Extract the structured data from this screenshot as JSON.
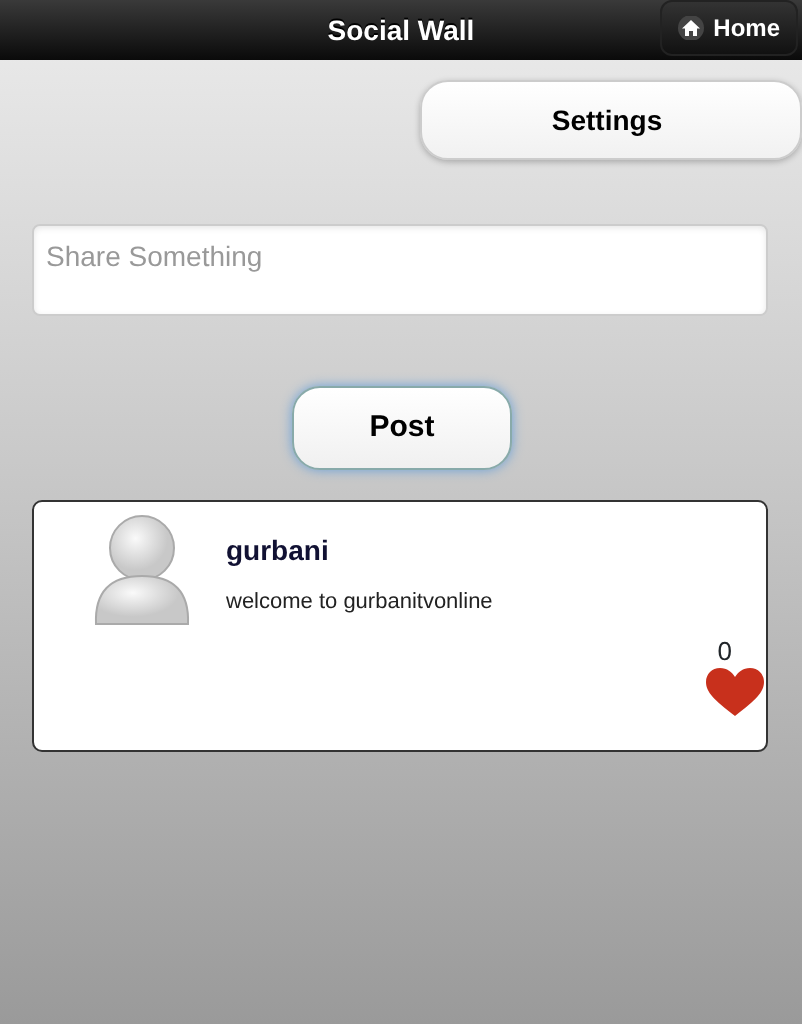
{
  "header": {
    "title": "Social Wall",
    "home_button": "Home"
  },
  "settings_button": "Settings",
  "share_field": {
    "placeholder": "Share Something"
  },
  "post_button": "Post",
  "posts": [
    {
      "author": "gurbani",
      "message": "welcome to gurbanitvonline",
      "likes": "0"
    }
  ]
}
